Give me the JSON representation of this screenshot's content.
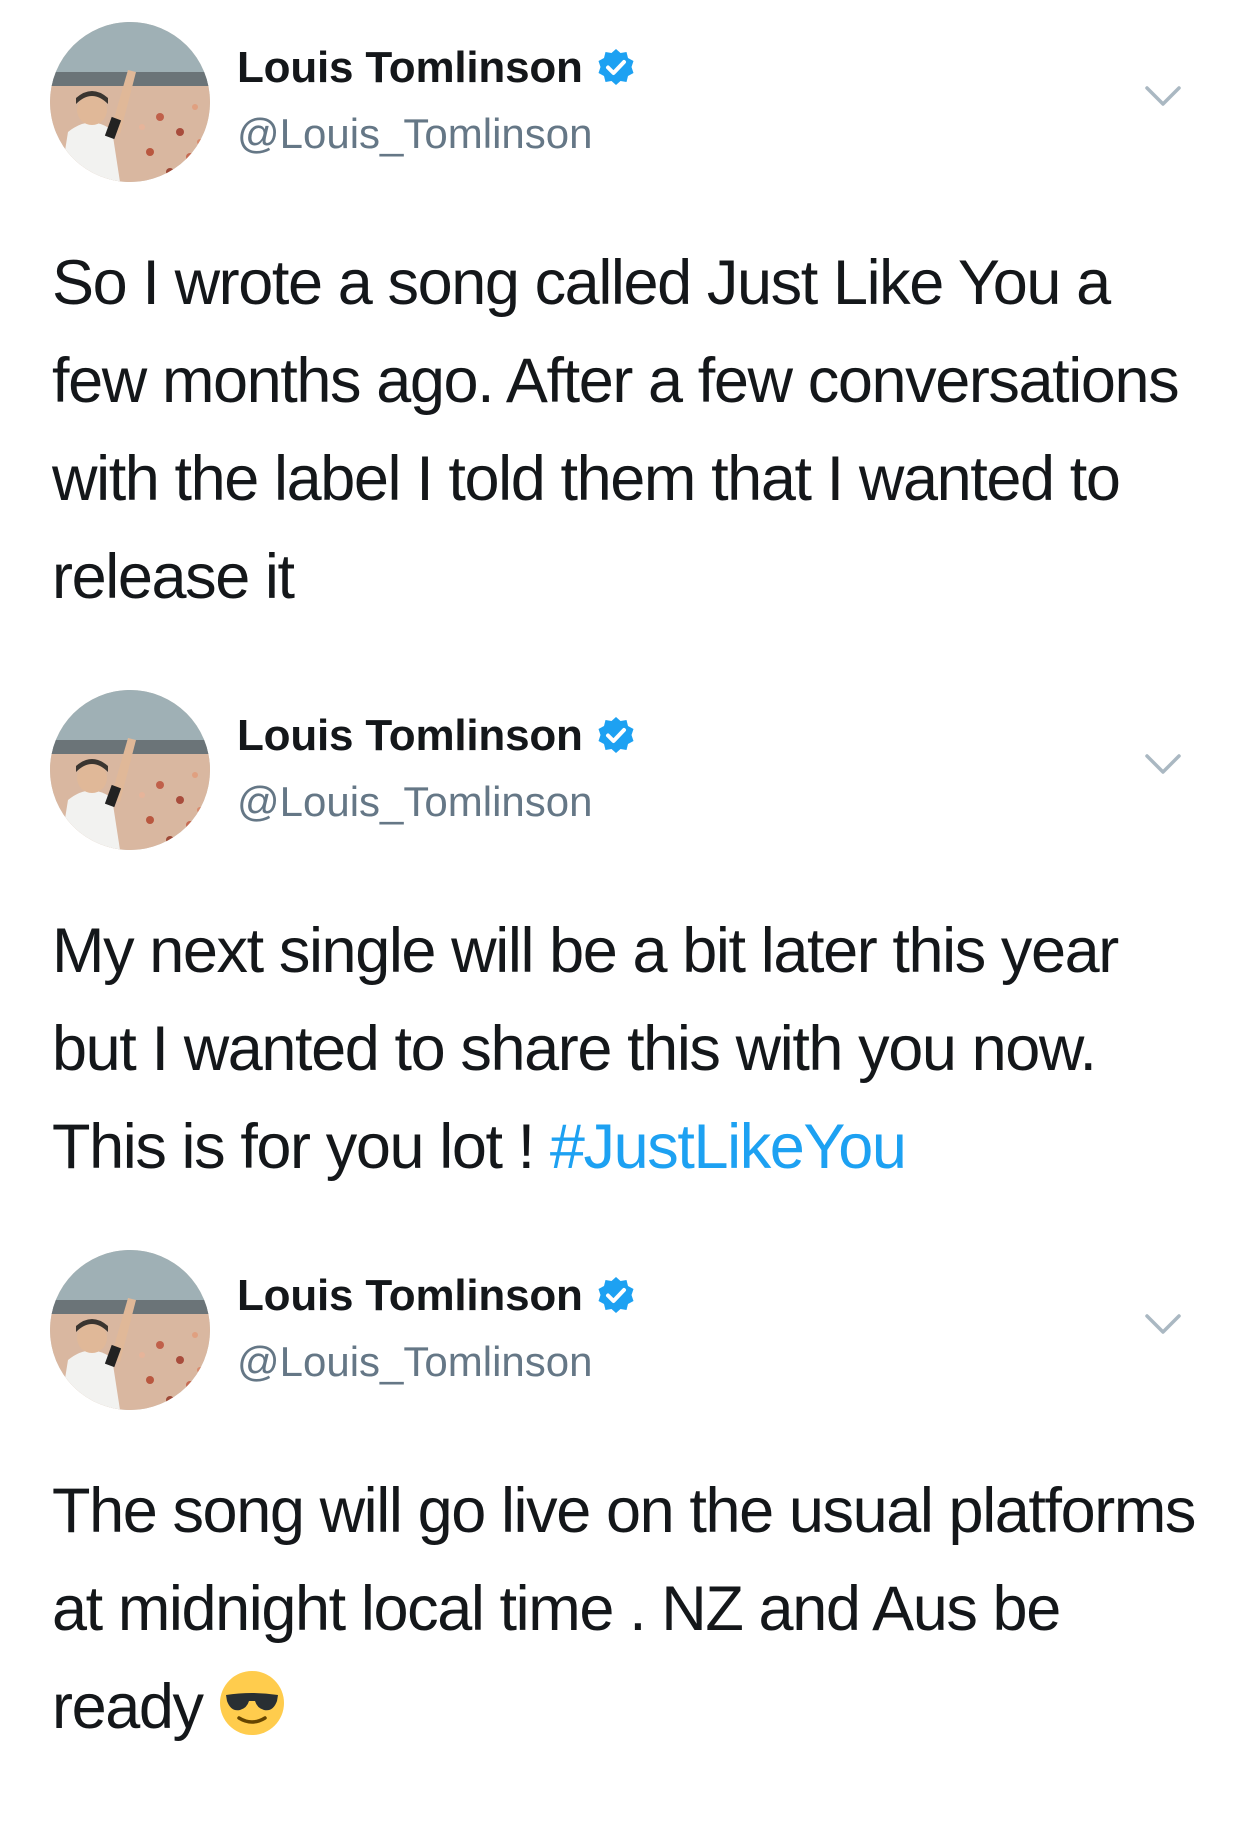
{
  "tweets": [
    {
      "author": {
        "name": "Louis Tomlinson",
        "handle": "@Louis_Tomlinson",
        "verified": true
      },
      "text": "So I wrote a song called Just Like You  a few months ago. After a few conversations with the label I told them that I wanted to release it",
      "menu_icon": "chevron-down-icon"
    },
    {
      "author": {
        "name": "Louis Tomlinson",
        "handle": "@Louis_Tomlinson",
        "verified": true
      },
      "text": "My next single will be a bit later this year but I wanted to share this with you now. This is for you lot ! ",
      "hashtag": "#JustLikeYou",
      "menu_icon": "chevron-down-icon"
    },
    {
      "author": {
        "name": "Louis Tomlinson",
        "handle": "@Louis_Tomlinson",
        "verified": true
      },
      "text": "The song will go live on the usual platforms at midnight local time . NZ and Aus be ready",
      "emoji": "smiling-face-with-sunglasses-icon",
      "menu_icon": "chevron-down-icon"
    }
  ],
  "colors": {
    "text": "#14171a",
    "secondary": "#657786",
    "link": "#1da1f2",
    "verified": "#1da1f2",
    "chevron": "#aab8c2"
  }
}
